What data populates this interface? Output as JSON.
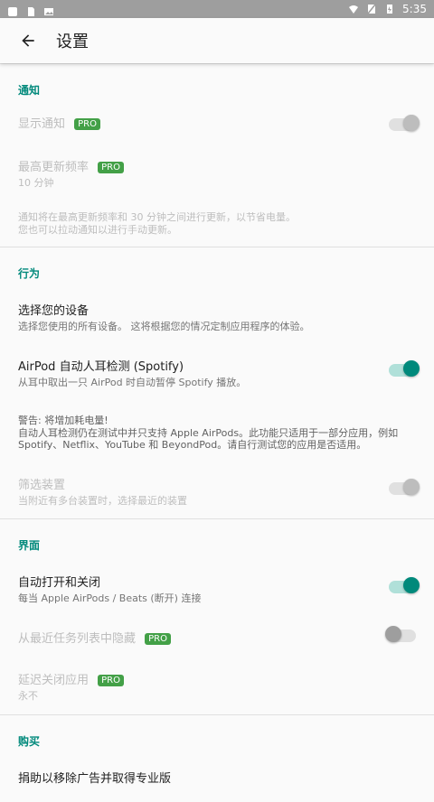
{
  "status_bar": {
    "time": "5:35"
  },
  "appbar": {
    "title": "设置"
  },
  "sections": {
    "notifications": {
      "header": "通知",
      "show_notification": {
        "title": "显示通知",
        "pro": "PRO"
      },
      "max_update": {
        "title": "最高更新频率",
        "pro": "PRO",
        "value": "10 分钟"
      },
      "note_line1": "通知将在最高更新频率和 30 分钟之间进行更新，以节省电量。",
      "note_line2": "您也可以拉动通知以进行手动更新。"
    },
    "behavior": {
      "header": "行为",
      "choose_device": {
        "title": "选择您的设备",
        "subtitle": "选择您使用的所有设备。 这将根据您的情况定制应用程序的体验。"
      },
      "ear_detect": {
        "title": "AirPod 自动人耳检测 (Spotify)",
        "subtitle": "从耳中取出一只 AirPod 时自动暂停 Spotify 播放。"
      },
      "warning_line1": "警告: 将增加耗电量!",
      "warning_line2": "自动人耳检测仍在测试中并只支持 Apple AirPods。此功能只适用于一部分应用，例如 Spotify、Netflix、YouTube 和 BeyondPod。请自行测试您的应用是否适用。",
      "filter_device": {
        "title": "筛选装置",
        "subtitle": "当附近有多台装置时，选择最近的装置"
      }
    },
    "interface": {
      "header": "界面",
      "auto_open_close": {
        "title": "自动打开和关闭",
        "subtitle": "每当 Apple AirPods / Beats (断开) 连接"
      },
      "hide_recents": {
        "title": "从最近任务列表中隐藏",
        "pro": "PRO"
      },
      "delay_close": {
        "title": "延迟关闭应用",
        "pro": "PRO",
        "value": "永不"
      }
    },
    "purchase": {
      "header": "购买",
      "donate": "捐助以移除广告并取得专业版"
    }
  }
}
